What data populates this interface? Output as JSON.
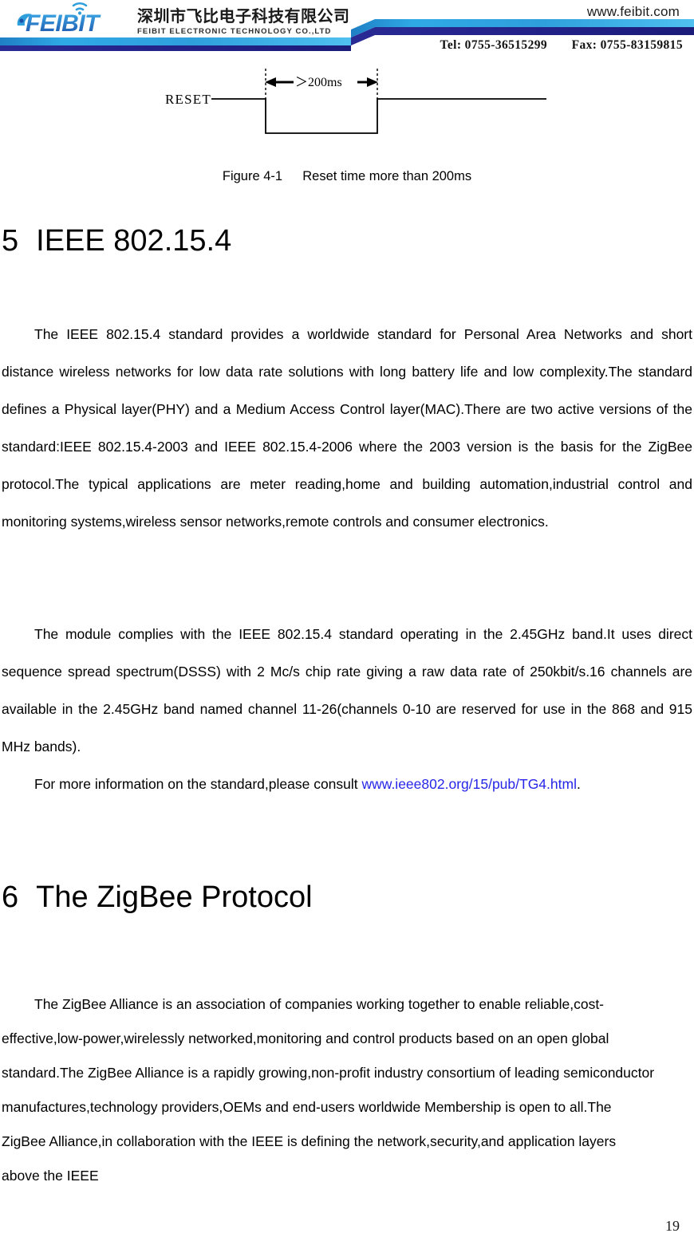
{
  "header": {
    "logo_icon": "feibit-logo-wifi-wave",
    "brand_latin": "FEIBIT",
    "company_cn": "深圳市飞比电子科技有限公司",
    "company_en": "FEIBIT ELECTRONIC TECHNOLOGY CO.,LTD",
    "website": "www.feibit.com",
    "tel_label": "Tel:",
    "tel_value": "0755-36515299",
    "fax_label": "Fax:",
    "fax_value": "0755-83159815",
    "band_color_light": "#2aa3e0",
    "band_color_dark": "#23228c"
  },
  "figure": {
    "signal_label": "RESET",
    "duration_label": "＞200ms",
    "caption_number": "Figure 4-1",
    "caption_text": "Reset time more than 200ms"
  },
  "sections": [
    {
      "number": "5",
      "title": "IEEE 802.15.4"
    },
    {
      "number": "6",
      "title": "The ZigBee Protocol"
    }
  ],
  "paragraphs": {
    "p1": "The IEEE 802.15.4 standard provides a worldwide standard for Personal Area Networks and short distance wireless networks for low data rate solutions with long battery life and low complexity.The standard defines a Physical layer(PHY) and a Medium Access Control layer(MAC).There are two active versions of the standard:IEEE 802.15.4-2003 and IEEE 802.15.4-2006 where the 2003 version is the basis for the ZigBee protocol.The typical applications are meter reading,home and building automation,industrial control and monitoring systems,wireless sensor networks,remote controls and consumer electronics.",
    "p2": "The module complies with the IEEE 802.15.4 standard operating in the 2.45GHz band.It uses direct sequence spread spectrum(DSSS) with 2 Mc/s chip rate giving a raw data rate of 250kbit/s.16 channels are available in the 2.45GHz band named channel 11-26(channels 0-10 are reserved for use in the 868 and 915 MHz bands).",
    "p3_before_link": "For more information on the standard,please consult ",
    "p3_link_text": "www.ieee802.org/15/pub/TG4.html",
    "p3_after_link": ".",
    "p4": "The ZigBee Alliance is an association of companies working together to enable reliable,cost-effective,low-power,wirelessly networked,monitoring and control products based on an open global standard.The ZigBee Alliance is a rapidly growing,non-profit industry consortium of leading semiconductor manufactures,technology providers,OEMs and end-users worldwide Membership is open to all.The ZigBee Alliance,in collaboration with the IEEE is defining the network,security,and application layers above the IEEE"
  },
  "footer": {
    "page_number": "19"
  },
  "link_color": "#2626e8"
}
